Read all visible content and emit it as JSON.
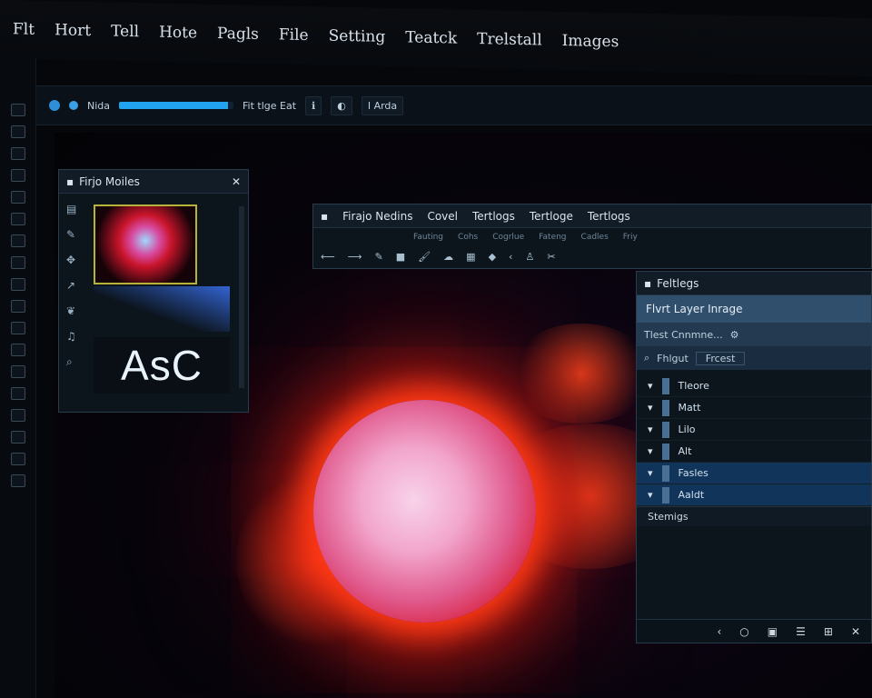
{
  "menu": [
    "Flt",
    "Hort",
    "Tell",
    "Hote",
    "Pagls",
    "File",
    "Setting",
    "Teatck",
    "Trelstall",
    "Images"
  ],
  "toolbar": {
    "label": "Nida",
    "progress": 0.95,
    "fit_label": "Fit tlge Eat",
    "zoom_label": "I Arda"
  },
  "panel_left": {
    "title": "Firjo Moiles",
    "preview_text": "AsC"
  },
  "panel_mid": {
    "title": "Firajo Nedins",
    "tabs": [
      "Covel",
      "Tertlogs",
      "Tertloge",
      "Tertlogs"
    ],
    "subtabs": [
      "Fauting",
      "Cohs",
      "Cogrlue",
      "Fateng",
      "Cadles",
      "Friy"
    ]
  },
  "panel_right": {
    "title": "Feltlegs",
    "header": "Flvrt Layer Inrage",
    "subheader": "Tlest Cnnmne...",
    "filter_label": "Fhlgut",
    "filter_value": "Frcest",
    "layers": [
      {
        "name": "Tleore",
        "selected": false
      },
      {
        "name": "Matt",
        "selected": false
      },
      {
        "name": "Lilo",
        "selected": false
      },
      {
        "name": "Alt",
        "selected": false
      },
      {
        "name": "Fasles",
        "selected": true
      },
      {
        "name": "Aaldt",
        "selected": true
      }
    ],
    "footer_tab": "Stemigs"
  },
  "colors": {
    "accent": "#22a3f0",
    "star_core": "#f2a6cc",
    "flare": "#ff3a15"
  }
}
